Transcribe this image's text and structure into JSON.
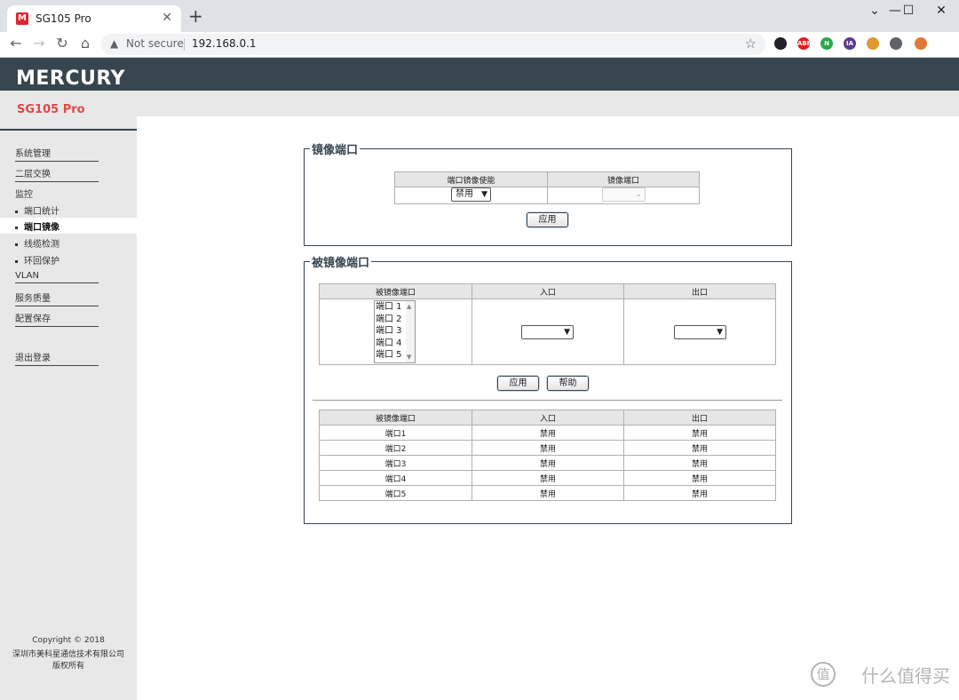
{
  "browser": {
    "tab_title": "SG105 Pro",
    "tab_favicon": "M",
    "security_label": "Not secure",
    "url": "192.168.0.1",
    "extensions": [
      {
        "name": "ext-1",
        "label": "",
        "color": "#202124"
      },
      {
        "name": "adblock-plus",
        "label": "ABP",
        "color": "#e02020"
      },
      {
        "name": "ext-n",
        "label": "N",
        "color": "#2aa84a"
      },
      {
        "name": "ext-ia",
        "label": "IA",
        "color": "#5b3e8c"
      },
      {
        "name": "ext-cookie",
        "label": "",
        "color": "#e09a30"
      },
      {
        "name": "extensions-puzzle",
        "label": "",
        "color": "#5f6368"
      },
      {
        "name": "ext-squirrel",
        "label": "",
        "color": "#e0783a"
      }
    ]
  },
  "header": {
    "brand": "MERCURY",
    "model": "SG105 Pro"
  },
  "sidebar": {
    "items": [
      {
        "label": "系统管理",
        "type": "main"
      },
      {
        "label": "二层交换",
        "type": "main"
      },
      {
        "label": "监控",
        "type": "plain"
      },
      {
        "label": "端口统计",
        "type": "sub"
      },
      {
        "label": "端口镜像",
        "type": "sub",
        "active": true
      },
      {
        "label": "线缆检测",
        "type": "sub"
      },
      {
        "label": "环回保护",
        "type": "sub"
      },
      {
        "label": "VLAN",
        "type": "main"
      },
      {
        "label": "服务质量",
        "type": "main"
      },
      {
        "label": "配置保存",
        "type": "main"
      },
      {
        "label": "退出登录",
        "type": "main"
      }
    ],
    "copyright": [
      "Copyright © 2018",
      "深圳市美科星通信技术有限公司",
      "版权所有"
    ]
  },
  "mirror_port": {
    "legend": "镜像端口",
    "col_enable": "端口镜像使能",
    "col_port": "镜像端口",
    "enable_value": "禁用",
    "port_value": "",
    "apply_label": "应用"
  },
  "mirrored_port": {
    "legend": "被镜像端口",
    "col_port": "被镜像端口",
    "col_in": "入口",
    "col_out": "出口",
    "port_options": [
      "端口 1",
      "端口 2",
      "端口 3",
      "端口 4",
      "端口 5"
    ],
    "in_value": "",
    "out_value": "",
    "apply_label": "应用",
    "help_label": "帮助",
    "summary_headers": [
      "被镜像端口",
      "入口",
      "出口"
    ],
    "summary_rows": [
      [
        "端口1",
        "禁用",
        "禁用"
      ],
      [
        "端口2",
        "禁用",
        "禁用"
      ],
      [
        "端口3",
        "禁用",
        "禁用"
      ],
      [
        "端口4",
        "禁用",
        "禁用"
      ],
      [
        "端口5",
        "禁用",
        "禁用"
      ]
    ]
  },
  "watermark": "值 什么值得买"
}
